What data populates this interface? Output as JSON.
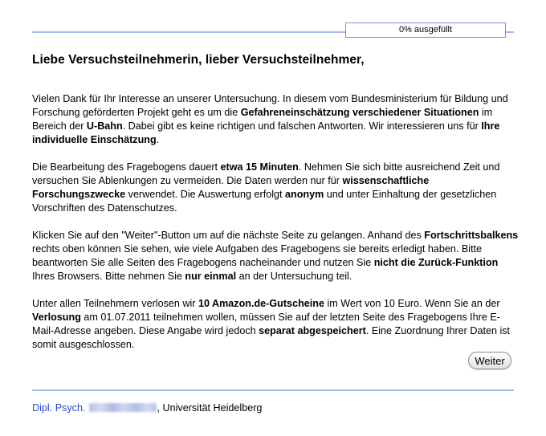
{
  "progress": {
    "label": "0% ausgefüllt",
    "percent": 0,
    "fill_color": "#a9b9ef",
    "border_color": "#7e8fd6"
  },
  "title": "Liebe Versuchsteilnehmerin, lieber Versuchsteilnehmer,",
  "paragraphs": [
    [
      {
        "t": "Vielen Dank für Ihr Interesse an unserer Untersuchung. In diesem vom Bundesministerium für Bildung und Forschung geförderten Projekt geht es um die "
      },
      {
        "t": "Gefahreneinschätzung verschiedener Situationen",
        "b": true
      },
      {
        "t": " im Bereich der "
      },
      {
        "t": "U-Bahn",
        "b": true
      },
      {
        "t": ". Dabei gibt es keine richtigen und falschen Antworten. Wir interessieren uns für "
      },
      {
        "t": "Ihre individuelle Einschätzung",
        "b": true
      },
      {
        "t": "."
      }
    ],
    [
      {
        "t": "Die Bearbeitung des Fragebogens dauert "
      },
      {
        "t": "etwa 15 Minuten",
        "b": true
      },
      {
        "t": ". Nehmen Sie sich bitte ausreichend Zeit und versuchen Sie Ablenkungen zu vermeiden. Die Daten werden nur für "
      },
      {
        "t": "wissenschaftliche Forschungszwecke",
        "b": true
      },
      {
        "t": " verwendet. Die Auswertung erfolgt "
      },
      {
        "t": "anonym",
        "b": true
      },
      {
        "t": " und unter Einhaltung der gesetzlichen Vorschriften des Datenschutzes."
      }
    ],
    [
      {
        "t": "Klicken Sie auf den \"Weiter\"-Button um auf die nächste Seite zu gelangen. Anhand des "
      },
      {
        "t": "Fortschrittsbalkens",
        "b": true
      },
      {
        "t": " rechts oben können Sie sehen, wie viele Aufgaben des Fragebogens sie bereits erledigt haben. Bitte beantworten Sie alle Seiten des Fragebogens nacheinander und nutzen Sie "
      },
      {
        "t": "nicht die Zurück-Funktion",
        "b": true
      },
      {
        "t": " Ihres Browsers. Bitte nehmen Sie "
      },
      {
        "t": "nur einmal",
        "b": true
      },
      {
        "t": " an der Untersuchung teil."
      }
    ],
    [
      {
        "t": "Unter allen Teilnehmern verlosen wir "
      },
      {
        "t": "10 Amazon.de-Gutscheine",
        "b": true
      },
      {
        "t": " im Wert von 10 Euro. Wenn Sie an der "
      },
      {
        "t": "Verlosung",
        "b": true
      },
      {
        "t": " am 01.07.2011 teilnehmen wollen, müssen Sie auf der letzten Seite des Fragebogens Ihre E-Mail-Adresse angeben. Diese Angabe wird jedoch "
      },
      {
        "t": "separat abgespeichert",
        "b": true
      },
      {
        "t": ". Eine Zuordnung Ihrer Daten ist somit ausgeschlossen."
      }
    ]
  ],
  "weiter_button": "Weiter",
  "footer": {
    "author_prefix": "Dipl. Psych.",
    "affiliation": ", Universität Heidelberg",
    "author_color": "#2a4bd7"
  }
}
